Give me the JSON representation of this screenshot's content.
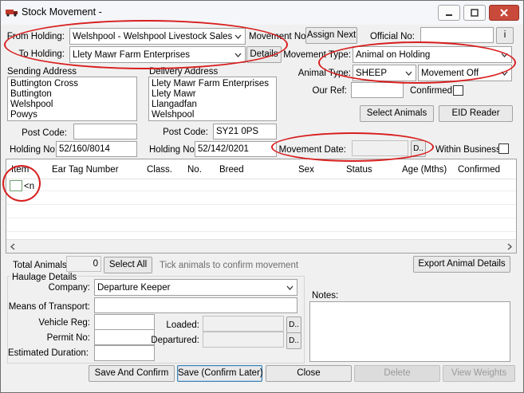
{
  "window": {
    "title": "Stock Movement -"
  },
  "header": {
    "from_holding_label": "From Holding:",
    "from_holding_value": "Welshpool - Welshpool Livestock Sales",
    "to_holding_label": "To Holding:",
    "to_holding_value": "Llety Mawr Farm Enterprises",
    "movement_no_label": "Movement No:",
    "assign_next_label": "Assign Next",
    "official_no_label": "Official No:",
    "official_no_value": "",
    "info_button_label": "i",
    "details_label": "Details",
    "movement_type_label": "Movement Type:",
    "movement_type_value": "Animal on Holding",
    "animal_type_label": "Animal Type:",
    "animal_type_value": "SHEEP",
    "movement_off_value": "Movement Off",
    "our_ref_label": "Our Ref:",
    "our_ref_value": "",
    "confirmed_label": "Confirmed:",
    "select_animals_label": "Select Animals",
    "eid_reader_label": "EID Reader"
  },
  "sending": {
    "address_label": "Sending Address",
    "address_lines": [
      "Buttington Cross",
      "Buttington",
      "Welshpool",
      "Powys"
    ],
    "post_code_label": "Post Code:",
    "post_code_value": "",
    "holding_no_label": "Holding No:",
    "holding_no_value": "52/160/8014"
  },
  "delivery": {
    "address_label": "Delivery Address",
    "address_lines": [
      "Llety Mawr Farm Enterprises",
      "Llety Mawr",
      "Llangadfan",
      "Welshpool"
    ],
    "post_code_label": "Post Code:",
    "post_code_value": "SY21 0PS",
    "holding_no_label": "Holding No:",
    "holding_no_value": "52/142/0201"
  },
  "movement_date": {
    "label": "Movement Date:",
    "value": "",
    "picker_label": "D..",
    "within_business_label": "Within Business"
  },
  "grid": {
    "columns": [
      "Item",
      "Ear Tag Number",
      "Class.",
      "No.",
      "Breed",
      "Sex",
      "Status",
      "Age (Mths)",
      "Confirmed"
    ],
    "new_row_text": "<n"
  },
  "totals": {
    "total_animals_label": "Total Animals:",
    "total_animals_value": "0",
    "select_all_label": "Select All",
    "tick_hint": "Tick animals to confirm movement",
    "export_label": "Export Animal Details"
  },
  "haulage": {
    "group_label": "Haulage Details",
    "company_label": "Company:",
    "company_value": "Departure Keeper",
    "means_label": "Means of Transport:",
    "means_value": "",
    "vehicle_reg_label": "Vehicle Reg:",
    "vehicle_reg_value": "",
    "permit_no_label": "Permit No:",
    "permit_no_value": "",
    "est_duration_label": "Estimated Duration:",
    "est_duration_value": "",
    "loaded_label": "Loaded:",
    "loaded_value": "",
    "departured_label": "Departured:",
    "departured_value": "",
    "picker_label": "D.."
  },
  "notes": {
    "label": "Notes:",
    "value": ""
  },
  "footer": {
    "save_confirm": "Save And Confirm",
    "save_confirm_later": "Save (Confirm Later)",
    "close": "Close",
    "delete": "Delete",
    "view_weights": "View Weights"
  },
  "colors": {
    "annotation_red": "#d81e1e",
    "close_button": "#c94a3a"
  }
}
